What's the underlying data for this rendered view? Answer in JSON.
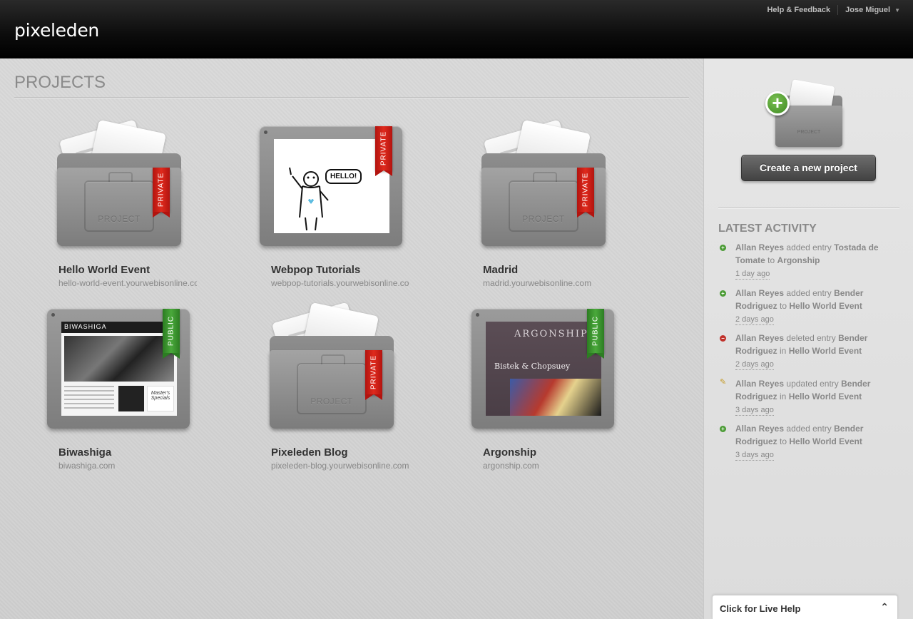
{
  "header": {
    "logo": "pixeleden",
    "help_link": "Help & Feedback",
    "user_menu": "Jose Miguel"
  },
  "main": {
    "title": "PROJECTS",
    "projects": [
      {
        "name": "Hello World Event",
        "url": "hello-world-event.yourwebisonline.com",
        "visibility": "PRIVATE",
        "thumbnail": "folder-icon"
      },
      {
        "name": "Webpop Tutorials",
        "url": "webpop-tutorials.yourwebisonline.com",
        "visibility": "PRIVATE",
        "thumbnail": "screenshot",
        "screenshot_text": "HELLO!"
      },
      {
        "name": "Madrid",
        "url": "madrid.yourwebisonline.com",
        "visibility": "PRIVATE",
        "thumbnail": "folder-icon"
      },
      {
        "name": "Biwashiga",
        "url": "biwashiga.com",
        "visibility": "PUBLIC",
        "thumbnail": "screenshot",
        "screenshot_text": "BIWASHIGA",
        "screenshot_text_2": "Master's Specials"
      },
      {
        "name": "Pixeleden Blog",
        "url": "pixeleden-blog.yourwebisonline.com",
        "visibility": "PRIVATE",
        "thumbnail": "folder-icon"
      },
      {
        "name": "Argonship",
        "url": "argonship.com",
        "visibility": "PUBLIC",
        "thumbnail": "screenshot",
        "screenshot_text": "ARGONSHIP",
        "screenshot_text_2": "Bistek & Chopsuey"
      }
    ],
    "folder_label": "PROJECT"
  },
  "sidebar": {
    "create_button": "Create a new project",
    "folder_label": "PROJECT",
    "activity_title": "LATEST ACTIVITY",
    "activity": [
      {
        "type": "add",
        "user": "Allan Reyes",
        "action": "added entry",
        "entry": "Tostada de Tomate",
        "prep": "to",
        "target": "Argonship",
        "time": "1 day ago"
      },
      {
        "type": "add",
        "user": "Allan Reyes",
        "action": "added entry",
        "entry": "Bender Rodriguez",
        "prep": "to",
        "target": "Hello World Event",
        "time": "2 days ago"
      },
      {
        "type": "delete",
        "user": "Allan Reyes",
        "action": "deleted entry",
        "entry": "Bender Rodriguez",
        "prep": "in",
        "target": "Hello World Event",
        "time": "2 days ago"
      },
      {
        "type": "update",
        "user": "Allan Reyes",
        "action": "updated entry",
        "entry": "Bender Rodriguez",
        "prep": "in",
        "target": "Hello World Event",
        "time": "3 days ago"
      },
      {
        "type": "add",
        "user": "Allan Reyes",
        "action": "added entry",
        "entry": "Bender Rodriguez",
        "prep": "to",
        "target": "Hello World Event",
        "time": "3 days ago"
      }
    ]
  },
  "live_help": {
    "label": "Click for Live Help"
  },
  "colors": {
    "private_ribbon": "#d9231a",
    "public_ribbon": "#3f9a31",
    "add_icon": "#4a9b34",
    "delete_icon": "#c0312a"
  }
}
